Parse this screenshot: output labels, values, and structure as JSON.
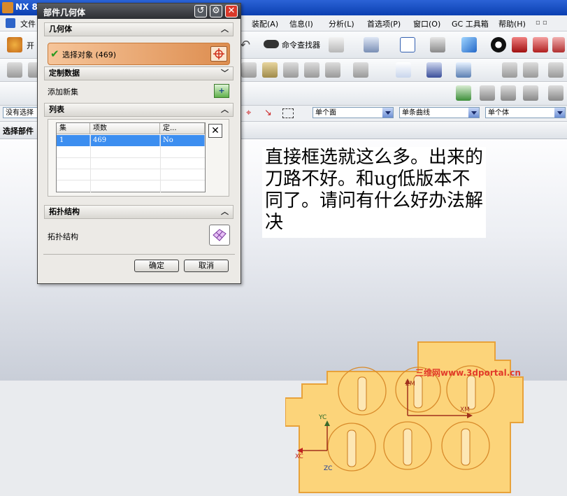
{
  "app": {
    "title": "NX 8"
  },
  "menubar": {
    "items": [
      "文件",
      "装配(A)",
      "信息(I)",
      "分析(L)",
      "首选项(P)",
      "窗口(O)",
      "GC 工具箱",
      "帮助(H)"
    ]
  },
  "toolbar": {
    "start_label": "开",
    "command_finder_label": "命令查找器"
  },
  "selection_bar": {
    "filter_value": "没有选择",
    "face_rule": "单个面",
    "curve_rule": "单条曲线",
    "body_rule": "单个体"
  },
  "nav": {
    "label": "选择部件"
  },
  "dialog": {
    "title": "部件几何体",
    "section_geometry": "几何体",
    "select_object": "选择对象 (469)",
    "section_custom_data": "定制数据",
    "add_new_set": "添加新集",
    "section_list": "列表",
    "table": {
      "headers": [
        "集",
        "项数",
        "定..."
      ],
      "rows": [
        [
          "1",
          "469",
          "No"
        ]
      ]
    },
    "section_topology": "拓扑结构",
    "topology_label": "拓扑结构",
    "ok": "确定",
    "cancel": "取消"
  },
  "viewport": {
    "axis_labels": {
      "yc": "YC",
      "xc": "XC",
      "zc": "ZC",
      "xm": "XM",
      "zm": "ZM"
    }
  },
  "annotation": {
    "text": "直接框选就这么多。出来的刀路不好。和ug低版本不同了。请问有什么好办法解决"
  },
  "watermark": {
    "text": "三维网www.3dportal.cn"
  },
  "colors": {
    "title_blue": "#0b3fb1",
    "select_orange": "#dd8d4f",
    "part_fill": "#fcd47a",
    "row_highlight": "#3c8ef0"
  }
}
